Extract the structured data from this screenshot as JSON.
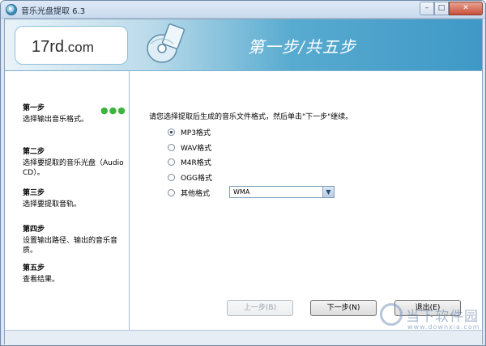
{
  "window": {
    "title": "音乐光盘提取 6.3",
    "minimize_label": "–",
    "maximize_label": "□",
    "close_label": "✕"
  },
  "banner": {
    "logo_main": "17rd",
    "logo_suffix": ".com",
    "step_title": "第一步/共五步"
  },
  "steps": [
    {
      "head": "第一步",
      "desc": "选择输出音乐格式。",
      "dots": "●●●"
    },
    {
      "head": "第二步",
      "desc": "选择要提取的音乐光盘（Audio CD）。"
    },
    {
      "head": "第三步",
      "desc": "选择要提取音轨。"
    },
    {
      "head": "第四步",
      "desc": "设置输出路径、输出的音乐音质。"
    },
    {
      "head": "第五步",
      "desc": "查看结果。"
    }
  ],
  "main": {
    "instruction": "请您选择提取后生成的音乐文件格式，然后单击\"下一步\"继续。",
    "formats": [
      {
        "label": "MP3格式",
        "selected": true
      },
      {
        "label": "WAV格式",
        "selected": false
      },
      {
        "label": "M4R格式",
        "selected": false
      },
      {
        "label": "OGG格式",
        "selected": false
      },
      {
        "label": "其他格式",
        "selected": false
      }
    ],
    "other_format_value": "WMA"
  },
  "footer": {
    "prev_label": "上一步(B)",
    "next_label": "下一步(N)",
    "exit_label": "退出(E)"
  },
  "watermark": {
    "text": "当下软件园",
    "url": "www.downxia.com"
  },
  "colors": {
    "banner_blue": "#3f98c6",
    "step_dots": "#3cb53c",
    "title_text": "#ffffff"
  }
}
